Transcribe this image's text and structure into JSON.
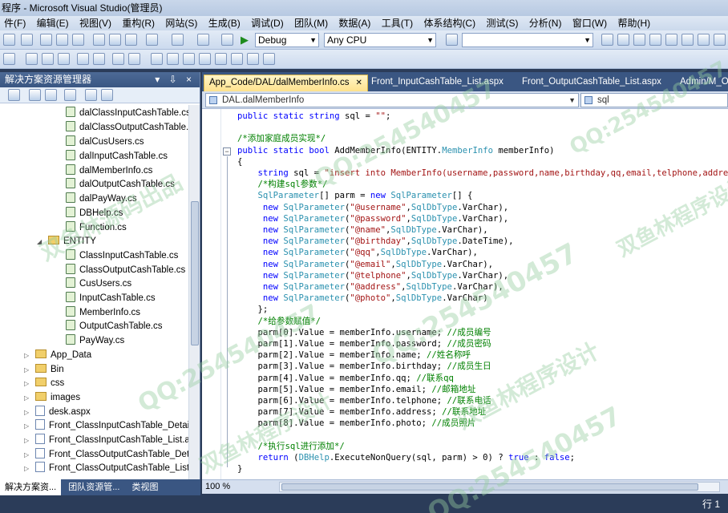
{
  "window": {
    "title": "程序 - Microsoft Visual Studio(管理员)"
  },
  "menu": [
    "件(F)",
    "编辑(E)",
    "视图(V)",
    "重构(R)",
    "网站(S)",
    "生成(B)",
    "调试(D)",
    "团队(M)",
    "数据(A)",
    "工具(T)",
    "体系结构(C)",
    "测试(S)",
    "分析(N)",
    "窗口(W)",
    "帮助(H)"
  ],
  "toolbar": {
    "config": "Debug",
    "platform": "Any CPU",
    "find": ""
  },
  "solution_explorer": {
    "title": "解决方案资源管理器",
    "controls": "▾ ⇩ ×",
    "items": [
      "dalClassInputCashTable.cs",
      "dalClassOutputCashTable.cs",
      "dalCusUsers.cs",
      "dalInputCashTable.cs",
      "dalMemberInfo.cs",
      "dalOutputCashTable.cs",
      "dalPayWay.cs",
      "DBHelp.cs",
      "Function.cs",
      "ENTITY",
      "ClassInputCashTable.cs",
      "ClassOutputCashTable.cs",
      "CusUsers.cs",
      "InputCashTable.cs",
      "MemberInfo.cs",
      "OutputCashTable.cs",
      "PayWay.cs",
      "App_Data",
      "Bin",
      "css",
      "images",
      "desk.aspx",
      "Front_ClassInputCashTable_Detail.aspx",
      "Front_ClassInputCashTable_List.aspx",
      "Front_ClassOutputCashTable_Detail.aspx",
      "Front_ClassOutputCashTable_List.aspx"
    ],
    "bottom_tabs": [
      "解决方案资...",
      "团队资源管...",
      "类视图"
    ]
  },
  "tabs": [
    {
      "label": "App_Code/DAL/dalMemberInfo.cs",
      "active": true
    },
    {
      "label": "Front_InputCashTable_List.aspx",
      "active": false
    },
    {
      "label": "Front_OutputCashTable_List.aspx",
      "active": false
    },
    {
      "label": "Admin/M_O",
      "active": false
    }
  ],
  "nav": {
    "type": "DAL.dalMemberInfo",
    "member": "sql"
  },
  "code_lines": [
    "public static string sql = \"\";",
    "",
    "/*添加家庭成员实现*/",
    "public static bool AddMemberInfo(ENTITY.MemberInfo memberInfo)",
    "{",
    "    string sql = \"insert into MemberInfo(username,password,name,birthday,qq,email,telphone,address,",
    "    /*构建sql参数*/",
    "    SqlParameter[] parm = new SqlParameter[] {",
    "     new SqlParameter(\"@username\",SqlDbType.VarChar),",
    "     new SqlParameter(\"@password\",SqlDbType.VarChar),",
    "     new SqlParameter(\"@name\",SqlDbType.VarChar),",
    "     new SqlParameter(\"@birthday\",SqlDbType.DateTime),",
    "     new SqlParameter(\"@qq\",SqlDbType.VarChar),",
    "     new SqlParameter(\"@email\",SqlDbType.VarChar),",
    "     new SqlParameter(\"@telphone\",SqlDbType.VarChar),",
    "     new SqlParameter(\"@address\",SqlDbType.VarChar),",
    "     new SqlParameter(\"@photo\",SqlDbType.VarChar)",
    "    };",
    "    /*给参数赋值*/",
    "    parm[0].Value = memberInfo.username; //成员编号",
    "    parm[1].Value = memberInfo.password; //成员密码",
    "    parm[2].Value = memberInfo.name; //姓名称呼",
    "    parm[3].Value = memberInfo.birthday; //成员生日",
    "    parm[4].Value = memberInfo.qq; //联系qq",
    "    parm[5].Value = memberInfo.email; //邮箱地址",
    "    parm[6].Value = memberInfo.telphone; //联系电话",
    "    parm[7].Value = memberInfo.address; //联系地址",
    "    parm[8].Value = memberInfo.photo; //成员照片",
    "",
    "    /*执行sql进行添加*/",
    "    return (DBHelp.ExecuteNonQuery(sql, parm) > 0) ? true : false;",
    "}"
  ],
  "editor_footer": {
    "zoom": "100 %"
  },
  "statusbar": {
    "position": "行 1"
  },
  "watermarks": [
    "QQ:254540457",
    "双鱼林程序设计",
    "双鱼林源码出品"
  ],
  "colors": {
    "keyword": "#0000ff",
    "type": "#2b91af",
    "string": "#a31515",
    "comment": "#008000",
    "active_tab": "#ffe28d",
    "chrome": "#3a5682"
  }
}
